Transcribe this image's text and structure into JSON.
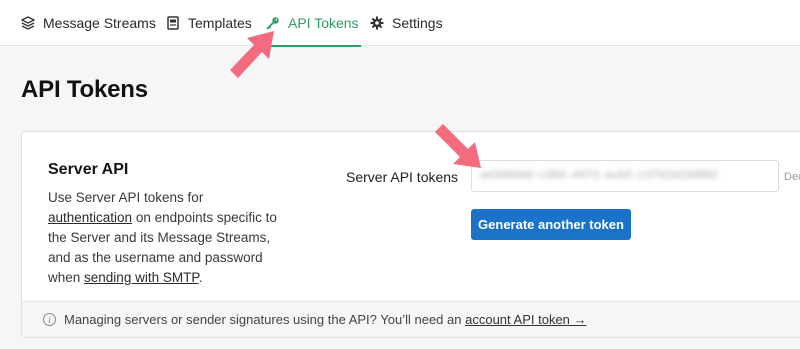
{
  "nav": {
    "tabs": [
      {
        "label": "Message Streams",
        "icon": "layers-icon"
      },
      {
        "label": "Templates",
        "icon": "template-icon"
      },
      {
        "label": "API Tokens",
        "icon": "key-icon",
        "active": true
      },
      {
        "label": "Settings",
        "icon": "gear-icon"
      }
    ]
  },
  "page": {
    "title": "API Tokens"
  },
  "server_api": {
    "title": "Server API",
    "desc_1": "Use Server API tokens for",
    "desc_link_1": "authentication",
    "desc_2": " on endpoints specific to the Server and its Message Streams, and as the username and password when ",
    "desc_link_2": "sending with SMTP",
    "desc_3": ".",
    "field_label": "Server API tokens",
    "token_value": "ae3dd4a9-c3b5-4473-ac62-c3752a23d882",
    "side_label": "Dec",
    "generate_label": "Generate another token"
  },
  "footer": {
    "text": "Managing servers or sender signatures using the API? You’ll need an ",
    "link": "account API token →"
  },
  "colors": {
    "accent_green": "#2e9b63",
    "button_blue": "#1a73c8",
    "arrow_pink": "#f36b7f"
  }
}
